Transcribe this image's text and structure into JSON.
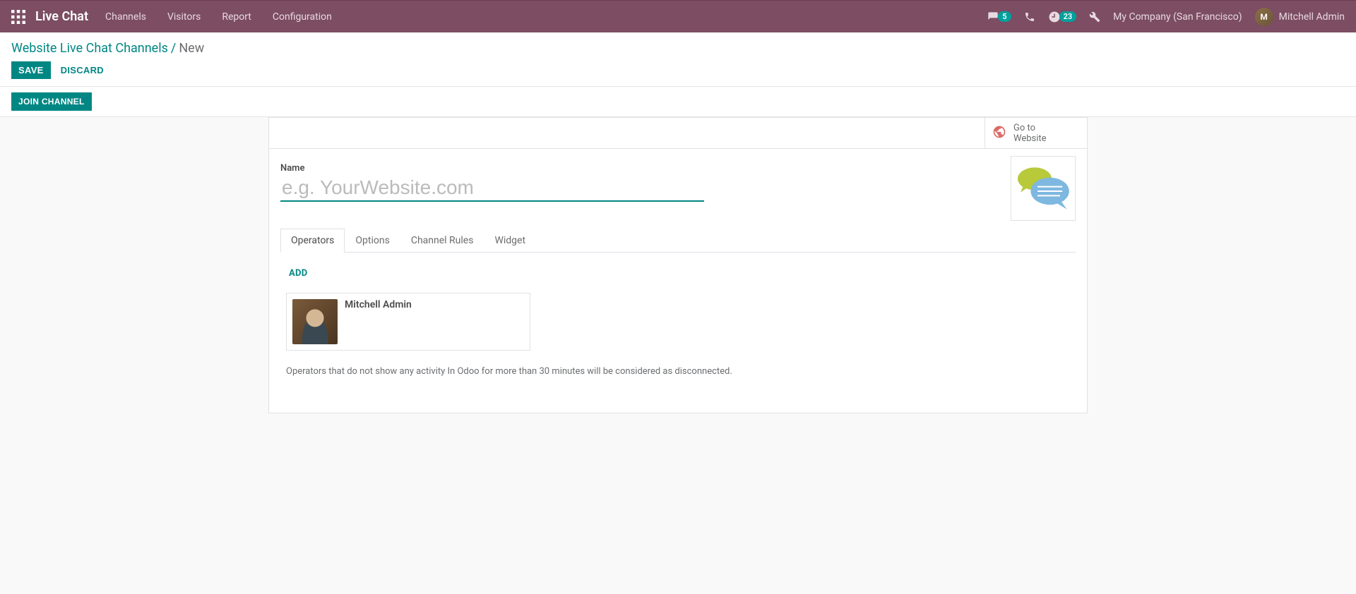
{
  "nav": {
    "app_title": "Live Chat",
    "menu": [
      "Channels",
      "Visitors",
      "Report",
      "Configuration"
    ],
    "messaging_count": "5",
    "activities_count": "23",
    "company": "My Company (San Francisco)",
    "user": "Mitchell Admin"
  },
  "breadcrumb": {
    "parent": "Website Live Chat Channels",
    "current": "New"
  },
  "buttons": {
    "save": "SAVE",
    "discard": "DISCARD",
    "join": "JOIN CHANNEL"
  },
  "stat_button": {
    "line1": "Go to",
    "line2": "Website"
  },
  "form": {
    "name_label": "Name",
    "name_placeholder": "e.g. YourWebsite.com",
    "name_value": ""
  },
  "tabs": [
    "Operators",
    "Options",
    "Channel Rules",
    "Widget"
  ],
  "operators": {
    "add": "ADD",
    "items": [
      {
        "name": "Mitchell Admin"
      }
    ],
    "help": "Operators that do not show any activity In Odoo for more than 30 minutes will be considered as disconnected."
  }
}
